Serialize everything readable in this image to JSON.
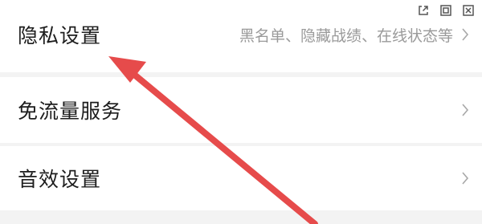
{
  "window_controls": [
    {
      "name": "popout-icon"
    },
    {
      "name": "restore-icon"
    },
    {
      "name": "close-icon"
    }
  ],
  "settings": [
    {
      "label": "隐私设置",
      "description": "黑名单、隐藏战绩、在线状态等"
    },
    {
      "label": "免流量服务"
    },
    {
      "label": "音效设置"
    }
  ],
  "annotation": {
    "color": "#e64b4b"
  }
}
